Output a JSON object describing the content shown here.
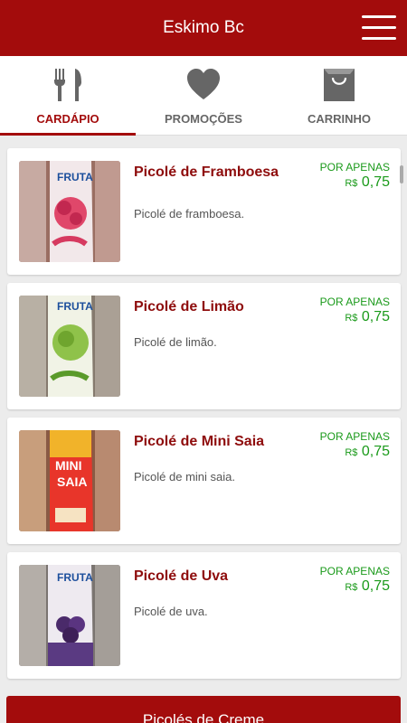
{
  "app": {
    "title": "Eskimo Bc",
    "menu_icon": "hamburger-menu-icon"
  },
  "tabs": [
    {
      "label": "CARDÁPIO",
      "icon": "fork-knife-icon",
      "active": true
    },
    {
      "label": "PROMOÇÕES",
      "icon": "heart-icon",
      "active": false
    },
    {
      "label": "CARRINHO",
      "icon": "shopping-bag-icon",
      "active": false
    }
  ],
  "products": [
    {
      "title": "Picolé de Framboesa",
      "description": "Picolé de framboesa.",
      "price_label": "POR APENAS",
      "currency": "R$",
      "price": "0,75"
    },
    {
      "title": "Picolé de Limão",
      "description": "Picolé de limão.",
      "price_label": "POR APENAS",
      "currency": "R$",
      "price": "0,75"
    },
    {
      "title": "Picolé de Mini Saia",
      "description": "Picolé de mini saia.",
      "price_label": "POR APENAS",
      "currency": "R$",
      "price": "0,75"
    },
    {
      "title": "Picolé de Uva",
      "description": "Picolé de uva.",
      "price_label": "POR APENAS",
      "currency": "R$",
      "price": "0,75"
    }
  ],
  "next_category": {
    "label": "Picolés de Creme"
  },
  "colors": {
    "brand": "#a30c0c",
    "price": "#1a9a1a",
    "tab_inactive": "#666666"
  }
}
